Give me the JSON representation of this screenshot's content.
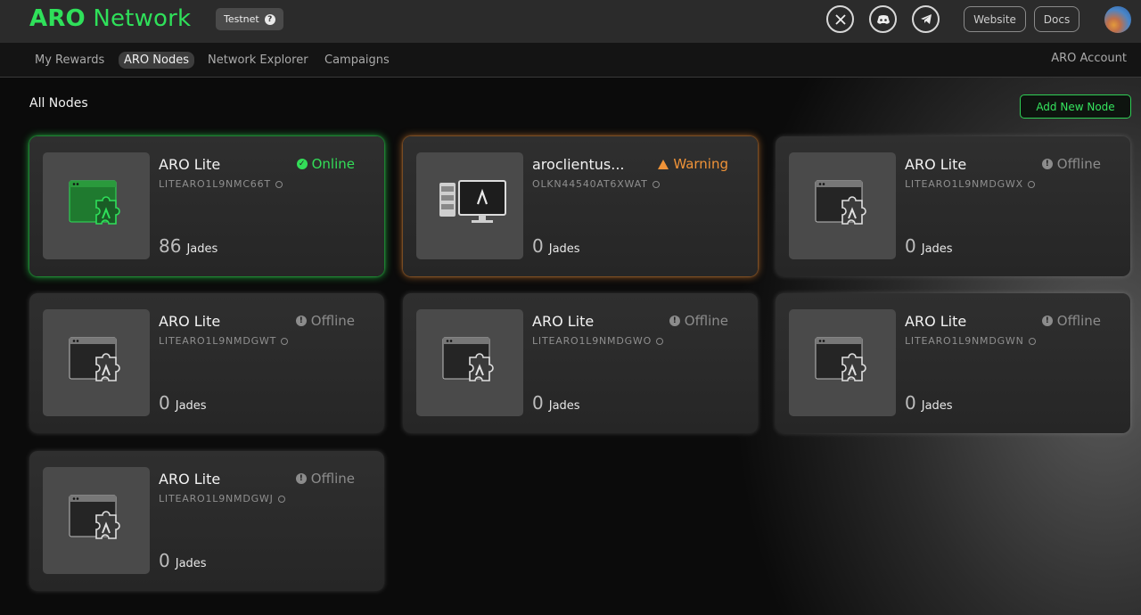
{
  "brand": {
    "bold": "ARO",
    "rest": " Network"
  },
  "network_badge": "Testnet",
  "header": {
    "social": [
      {
        "name": "x-icon",
        "glyph": "𝕏"
      },
      {
        "name": "discord-icon",
        "glyph": "◉"
      },
      {
        "name": "telegram-icon",
        "glyph": "➤"
      }
    ],
    "website_label": "Website",
    "docs_label": "Docs"
  },
  "nav": {
    "items": [
      "My Rewards",
      "ARO Nodes",
      "Network Explorer",
      "Campaigns"
    ],
    "active": "ARO Nodes",
    "account_label": "ARO Account"
  },
  "section": {
    "title": "All Nodes",
    "add_label": "Add New Node"
  },
  "colors": {
    "accent": "#2fe05a",
    "warning": "#f09338",
    "offline": "#8c8c8c"
  },
  "nodes": [
    {
      "title": "ARO Lite",
      "id": "LITEARO1L9NMC66T",
      "status": "Online",
      "reward": "86",
      "unit": "Jades",
      "icon": "lite-node-icon"
    },
    {
      "title": "aroclientus...",
      "id": "OLKN44540AT6XWAT",
      "status": "Warning",
      "reward": "0",
      "unit": "Jades",
      "icon": "server-node-icon"
    },
    {
      "title": "ARO Lite",
      "id": "LITEARO1L9NMDGWX",
      "status": "Offline",
      "reward": "0",
      "unit": "Jades",
      "icon": "lite-node-icon"
    },
    {
      "title": "ARO Lite",
      "id": "LITEARO1L9NMDGWT",
      "status": "Offline",
      "reward": "0",
      "unit": "Jades",
      "icon": "lite-node-icon"
    },
    {
      "title": "ARO Lite",
      "id": "LITEARO1L9NMDGWO",
      "status": "Offline",
      "reward": "0",
      "unit": "Jades",
      "icon": "lite-node-icon"
    },
    {
      "title": "ARO Lite",
      "id": "LITEARO1L9NMDGWN",
      "status": "Offline",
      "reward": "0",
      "unit": "Jades",
      "icon": "lite-node-icon"
    },
    {
      "title": "ARO Lite",
      "id": "LITEARO1L9NMDGWJ",
      "status": "Offline",
      "reward": "0",
      "unit": "Jades",
      "icon": "lite-node-icon"
    }
  ]
}
